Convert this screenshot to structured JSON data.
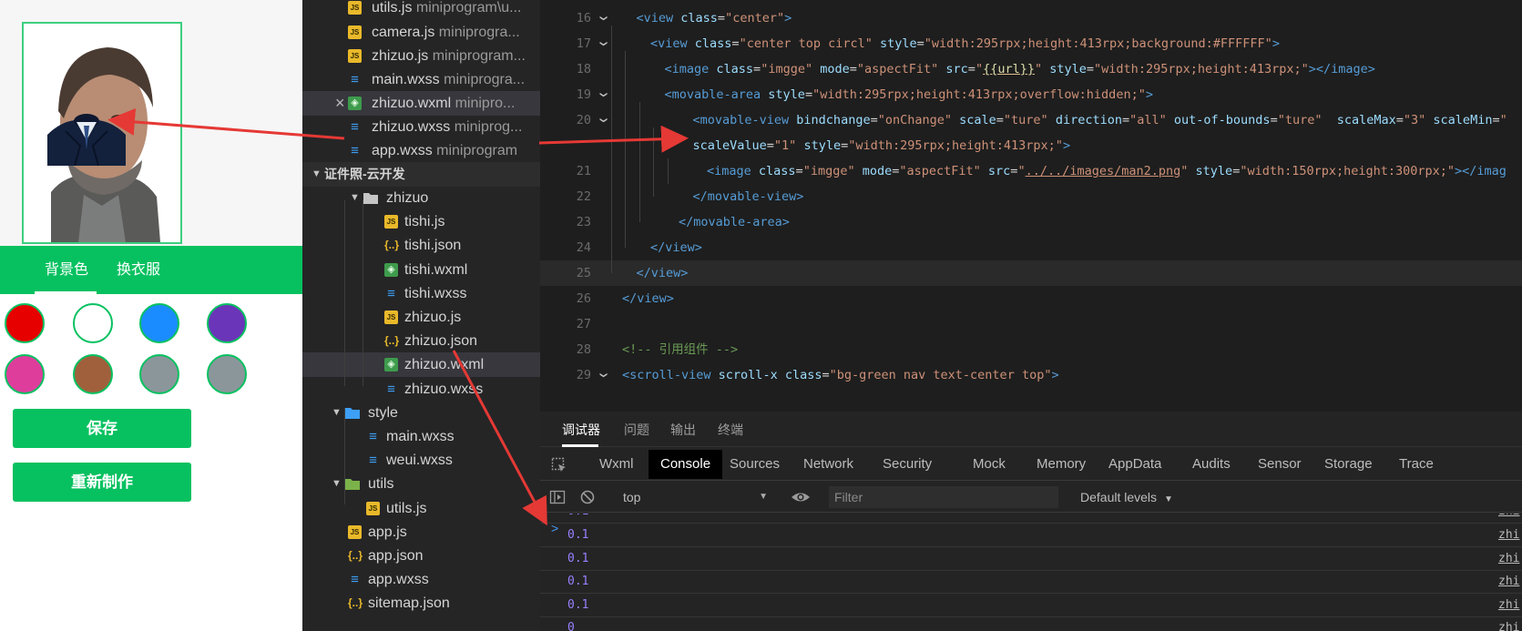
{
  "simulator": {
    "tabs": {
      "background": "背景色",
      "clothes": "换衣服"
    },
    "swatch_colors": [
      "#e60000",
      "#ffffff",
      "#1a8cff",
      "#6a35b8",
      "#de3d9c",
      "#a0603c",
      "#8b969b",
      "#8b969b"
    ],
    "buttons": {
      "save": "保存",
      "remake": "重新制作"
    }
  },
  "explorer": {
    "files_top": [
      {
        "name": "utils.js",
        "detail": "miniprogram\\u...",
        "icon": "js-file-icon"
      },
      {
        "name": "camera.js",
        "detail": "miniprogra...",
        "icon": "js-file-icon"
      },
      {
        "name": "zhizuo.js",
        "detail": "miniprogram...",
        "icon": "js-file-icon"
      },
      {
        "name": "main.wxss",
        "detail": "miniprogra...",
        "icon": "wxss-file-icon"
      },
      {
        "name": "zhizuo.wxml",
        "detail": "minipro...",
        "icon": "wxml-file-icon",
        "selected": true,
        "closable": true
      },
      {
        "name": "zhizuo.wxss",
        "detail": "miniprog...",
        "icon": "wxss-file-icon"
      },
      {
        "name": "app.wxss",
        "detail": "miniprogram",
        "icon": "wxss-file-icon"
      }
    ],
    "section": "证件照-云开发",
    "tree": [
      {
        "name": "zhizuo",
        "type": "folder",
        "level": 1,
        "open": true
      },
      {
        "name": "tishi.js",
        "type": "js",
        "level": 2
      },
      {
        "name": "tishi.json",
        "type": "json",
        "level": 2
      },
      {
        "name": "tishi.wxml",
        "type": "wxml",
        "level": 2
      },
      {
        "name": "tishi.wxss",
        "type": "wxss",
        "level": 2
      },
      {
        "name": "zhizuo.js",
        "type": "js",
        "level": 2
      },
      {
        "name": "zhizuo.json",
        "type": "json",
        "level": 2
      },
      {
        "name": "zhizuo.wxml",
        "type": "wxml",
        "level": 2,
        "selected": true
      },
      {
        "name": "zhizuo.wxss",
        "type": "wxss",
        "level": 2
      },
      {
        "name": "style",
        "type": "folder-css",
        "level": 0,
        "open": true
      },
      {
        "name": "main.wxss",
        "type": "wxss",
        "level": 1
      },
      {
        "name": "weui.wxss",
        "type": "wxss",
        "level": 1
      },
      {
        "name": "utils",
        "type": "folder-green",
        "level": 0,
        "open": true
      },
      {
        "name": "utils.js",
        "type": "js",
        "level": 1
      },
      {
        "name": "app.js",
        "type": "js",
        "level": 0
      },
      {
        "name": "app.json",
        "type": "json",
        "level": 0
      },
      {
        "name": "app.wxss",
        "type": "wxss",
        "level": 0
      },
      {
        "name": "sitemap.json",
        "type": "json",
        "level": 0
      }
    ]
  },
  "editor": {
    "lines": [
      {
        "n": "16",
        "fold": true,
        "ind": 1,
        "parts": [
          [
            "t-tag",
            "<view "
          ],
          [
            "t-attr",
            "class"
          ],
          [
            "",
            "="
          ],
          [
            "t-str",
            "\"center\""
          ],
          [
            "t-tag",
            ">"
          ]
        ]
      },
      {
        "n": "17",
        "fold": true,
        "ind": 2,
        "parts": [
          [
            "t-tag",
            "<view "
          ],
          [
            "t-attr",
            "class"
          ],
          [
            "",
            "="
          ],
          [
            "t-str",
            "\"center top circl\""
          ],
          [
            "t-attr",
            " style"
          ],
          [
            "",
            "="
          ],
          [
            "t-str",
            "\"width:295rpx;height:413rpx;background:#FFFFFF\""
          ],
          [
            "t-tag",
            ">"
          ]
        ]
      },
      {
        "n": "18",
        "fold": false,
        "ind": 3,
        "parts": [
          [
            "t-tag",
            "<image "
          ],
          [
            "t-attr",
            "class"
          ],
          [
            "",
            "="
          ],
          [
            "t-str",
            "\"imgge\""
          ],
          [
            "t-attr",
            " mode"
          ],
          [
            "",
            "="
          ],
          [
            "t-str",
            "\"aspectFit\""
          ],
          [
            "t-attr",
            " src"
          ],
          [
            "",
            "="
          ],
          [
            "t-str",
            "\""
          ],
          [
            "t-bind",
            "{{url}}"
          ],
          [
            "t-str",
            "\""
          ],
          [
            "t-attr",
            " style"
          ],
          [
            "",
            "="
          ],
          [
            "t-str",
            "\"width:295rpx;height:413rpx;\""
          ],
          [
            "t-tag",
            "></image>"
          ]
        ]
      },
      {
        "n": "19",
        "fold": true,
        "ind": 3,
        "parts": [
          [
            "t-tag",
            "<movable-area "
          ],
          [
            "t-attr",
            "style"
          ],
          [
            "",
            "="
          ],
          [
            "t-str",
            "\"width:295rpx;height:413rpx;overflow:hidden;\""
          ],
          [
            "t-tag",
            ">"
          ]
        ]
      },
      {
        "n": "20",
        "fold": true,
        "ind": 5,
        "parts": [
          [
            "t-tag",
            "<movable-view "
          ],
          [
            "t-attr",
            "bindchange"
          ],
          [
            "",
            "="
          ],
          [
            "t-str",
            "\"onChange\""
          ],
          [
            "t-attr",
            " scale"
          ],
          [
            "",
            "="
          ],
          [
            "t-str",
            "\"ture\""
          ],
          [
            "t-attr",
            " direction"
          ],
          [
            "",
            "="
          ],
          [
            "t-str",
            "\"all\""
          ],
          [
            "t-attr",
            " out-of-bounds"
          ],
          [
            "",
            "="
          ],
          [
            "t-str",
            "\"ture\""
          ],
          [
            "t-attr",
            "  scaleMax"
          ],
          [
            "",
            "="
          ],
          [
            "t-str",
            "\"3\""
          ],
          [
            "t-attr",
            " scaleMin"
          ],
          [
            "",
            "="
          ],
          [
            "t-str",
            "\""
          ]
        ]
      },
      {
        "n": "",
        "fold": false,
        "ind": 5,
        "parts": [
          [
            "t-attr",
            "scaleValue"
          ],
          [
            "",
            "="
          ],
          [
            "t-str",
            "\"1\""
          ],
          [
            "t-attr",
            " style"
          ],
          [
            "",
            "="
          ],
          [
            "t-str",
            "\"width:295rpx;height:413rpx;\""
          ],
          [
            "t-tag",
            ">"
          ]
        ]
      },
      {
        "n": "21",
        "fold": false,
        "ind": 6,
        "parts": [
          [
            "t-tag",
            "<image "
          ],
          [
            "t-attr",
            "class"
          ],
          [
            "",
            "="
          ],
          [
            "t-str",
            "\"imgge\""
          ],
          [
            "t-attr",
            " mode"
          ],
          [
            "",
            "="
          ],
          [
            "t-str",
            "\"aspectFit\""
          ],
          [
            "t-attr",
            " src"
          ],
          [
            "",
            "="
          ],
          [
            "t-str",
            "\""
          ],
          [
            "t-link",
            "../../images/man2.png"
          ],
          [
            "t-str",
            "\""
          ],
          [
            "t-attr",
            " style"
          ],
          [
            "",
            "="
          ],
          [
            "t-str",
            "\"width:150rpx;height:300rpx;\""
          ],
          [
            "t-tag",
            "></imag"
          ]
        ]
      },
      {
        "n": "22",
        "fold": false,
        "ind": 5,
        "parts": [
          [
            "t-tag",
            "</movable-view>"
          ]
        ]
      },
      {
        "n": "23",
        "fold": false,
        "ind": 4,
        "parts": [
          [
            "t-tag",
            "</movable-area>"
          ]
        ]
      },
      {
        "n": "24",
        "fold": false,
        "ind": 2,
        "parts": [
          [
            "t-tag",
            "</view>"
          ]
        ]
      },
      {
        "n": "25",
        "fold": false,
        "ind": 1,
        "active": true,
        "parts": [
          [
            "t-tag",
            "</view>"
          ]
        ]
      },
      {
        "n": "26",
        "fold": false,
        "ind": 0,
        "parts": [
          [
            "t-tag",
            "</view>"
          ]
        ]
      },
      {
        "n": "27",
        "fold": false,
        "ind": 0,
        "parts": []
      },
      {
        "n": "28",
        "fold": false,
        "ind": 0,
        "parts": [
          [
            "t-cmt",
            "<!-- 引用组件 -->"
          ]
        ]
      },
      {
        "n": "29",
        "fold": true,
        "ind": 0,
        "parts": [
          [
            "t-tag",
            "<scroll-view "
          ],
          [
            "t-attr",
            "scroll-x"
          ],
          [
            "t-attr",
            " class"
          ],
          [
            "",
            "="
          ],
          [
            "t-str",
            "\"bg-green nav text-center top\""
          ],
          [
            "t-tag",
            ">"
          ]
        ]
      }
    ]
  },
  "devtools": {
    "top_tabs": [
      "调试器",
      "问题",
      "输出",
      "终端"
    ],
    "panel_tabs": [
      "Wxml",
      "Console",
      "Sources",
      "Network",
      "Security",
      "Mock",
      "Memory",
      "AppData",
      "Audits",
      "Sensor",
      "Storage",
      "Trace"
    ],
    "active_panel": "Console",
    "context": "top",
    "filter_placeholder": "Filter",
    "levels": "Default levels",
    "logs": [
      {
        "value": "0.1",
        "source": "zhi"
      },
      {
        "value": "0.1",
        "source": "zhi"
      },
      {
        "value": "0.1",
        "source": "zhi"
      },
      {
        "value": "0.1",
        "source": "zhi"
      },
      {
        "value": "0",
        "source": "zhi"
      }
    ],
    "prompt": ">"
  }
}
